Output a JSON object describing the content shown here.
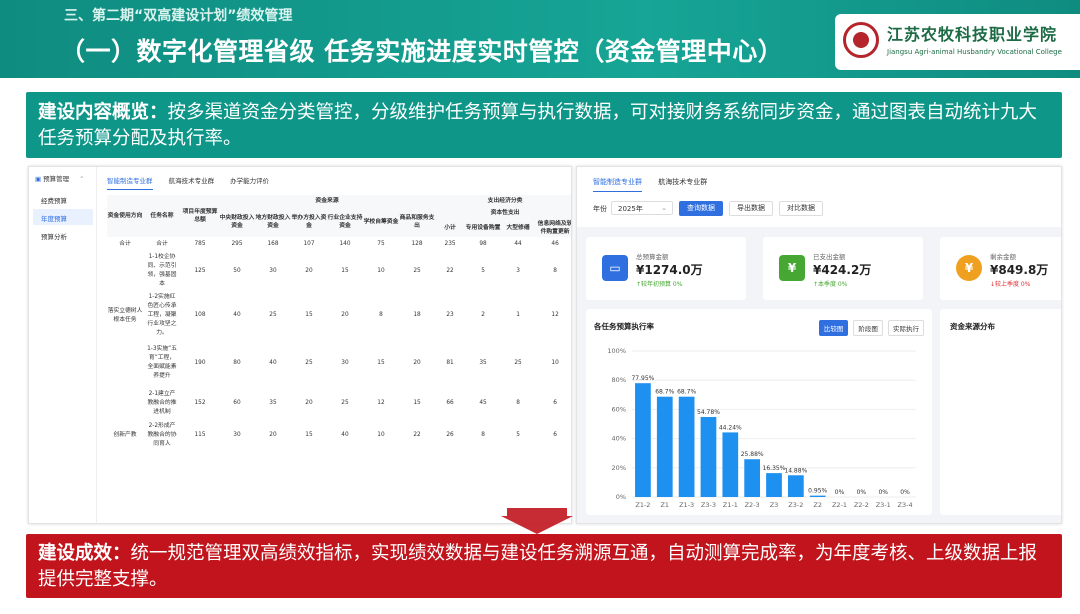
{
  "header": {
    "section_title": "三、第二期“双高建设计划”绩效管理",
    "main_title": "（一）数字化管理省级 任务实施进度实时管控（资金管理中心）",
    "logo_cn": "江苏农牧科技职业学院",
    "logo_en": "Jiangsu Agri-animal Husbandry Vocational College"
  },
  "intro": {
    "label": "建设内容概览：",
    "text": "按多渠道资金分类管控，分级维护任务预算与执行数据，可对接财务系统同步资金，通过图表自动统计九大任务预算分配及执行率。"
  },
  "result": {
    "label": "建设成效：",
    "text": "统一规范管理双高绩效指标，实现绩效数据与建设任务溯源互通，自动测算完成率，为年度考核、上级数据上报提供完整支撑。"
  },
  "left_screen": {
    "nav_group": "预算管理",
    "nav_items": [
      "经费预算",
      "年度预算",
      "预算分析"
    ],
    "tabs": [
      "智能制造专业群",
      "航海技术专业群",
      "办学能力评价"
    ],
    "header_row1": [
      "资金使用方向",
      "任务名称",
      "项目年度预算总额",
      "资金来源",
      "支出经济分类"
    ],
    "header_capital": "资本性支出",
    "sub_headers": [
      "中央财政投入资金",
      "地方财政投入资金",
      "举办方投入资金",
      "行业企业支持资金",
      "学校自筹资金",
      "商品和服务支出",
      "小计",
      "专用设备购置",
      "大型修缮",
      "信息网络及软件购置更新"
    ],
    "rows": [
      {
        "dir": "合计",
        "task": "合计",
        "vals": [
          "785",
          "295",
          "168",
          "107",
          "140",
          "75",
          "128",
          "235",
          "98",
          "44",
          "46"
        ]
      },
      {
        "dir": "",
        "task": "1-1校企协同、示范引领，强基固本",
        "vals": [
          "125",
          "50",
          "30",
          "20",
          "15",
          "10",
          "25",
          "22",
          "5",
          "3",
          "8"
        ]
      },
      {
        "dir": "落实立德树人根本任务",
        "task": "1-2实施红色匠心传承工程，凝聚行业攻坚之力。",
        "vals": [
          "108",
          "40",
          "25",
          "15",
          "20",
          "8",
          "18",
          "23",
          "2",
          "1",
          "12"
        ]
      },
      {
        "dir": "",
        "task": "1-3实施“五育”工程，全面赋能素养提升",
        "vals": [
          "190",
          "80",
          "40",
          "25",
          "30",
          "15",
          "20",
          "81",
          "35",
          "25",
          "10"
        ]
      },
      {
        "dir": "",
        "task": "2-1建立产教融合的推进机制",
        "vals": [
          "152",
          "60",
          "35",
          "20",
          "25",
          "12",
          "15",
          "66",
          "45",
          "8",
          "6"
        ]
      },
      {
        "dir": "创新产教",
        "task": "2-2形成产教融合的协同育人",
        "vals": [
          "115",
          "30",
          "20",
          "15",
          "40",
          "10",
          "22",
          "26",
          "8",
          "5",
          "6"
        ]
      }
    ]
  },
  "right_screen": {
    "tabs": [
      "智能制造专业群",
      "航海技术专业群"
    ],
    "year_label": "年份",
    "year_value": "2025年",
    "buttons": [
      "查询数据",
      "导出数据",
      "对比数据"
    ],
    "cards": [
      {
        "label": "总预算金额",
        "value": "¥1274.0万",
        "change": "↑较年初预算 0%",
        "color": "#2f6fe0",
        "icon": "budget-icon"
      },
      {
        "label": "已支出金额",
        "value": "¥424.2万",
        "change": "↑本季度 0%",
        "color": "#46a832",
        "icon": "calendar-icon"
      },
      {
        "label": "剩余金额",
        "value": "¥849.8万",
        "change": "↓较上季度 0%",
        "color": "#f0a020",
        "icon": "yuan-icon"
      }
    ],
    "chart_title": "各任务预算执行率",
    "chart_buttons": [
      "比较图",
      "阶段图",
      "实际执行"
    ],
    "source_title": "资金来源分布"
  },
  "chart_data": {
    "type": "bar",
    "title": "各任务预算执行率",
    "categories": [
      "Z1-2",
      "Z1",
      "Z1-3",
      "Z3-3",
      "Z1-1",
      "Z2-3",
      "Z3",
      "Z3-2",
      "Z2",
      "Z2-1",
      "Z2-2",
      "Z3-1",
      "Z3-4"
    ],
    "values": [
      77.95,
      68.7,
      68.7,
      54.78,
      44.24,
      25.88,
      16.35,
      14.88,
      0.95,
      0,
      0,
      0,
      0
    ],
    "value_labels": [
      "77.95%",
      "68.7%",
      "68.7%",
      "54.78%",
      "44.24%",
      "25.88%",
      "16.35%",
      "14.88%",
      "0.95%",
      "0%",
      "0%",
      "0%",
      "0%"
    ],
    "yticks": [
      "0%",
      "20%",
      "40%",
      "60%",
      "80%",
      "100%"
    ],
    "ylim": [
      0,
      100
    ],
    "color": "#1e90f0",
    "xlabel": "",
    "ylabel": "",
    "grid": true
  }
}
